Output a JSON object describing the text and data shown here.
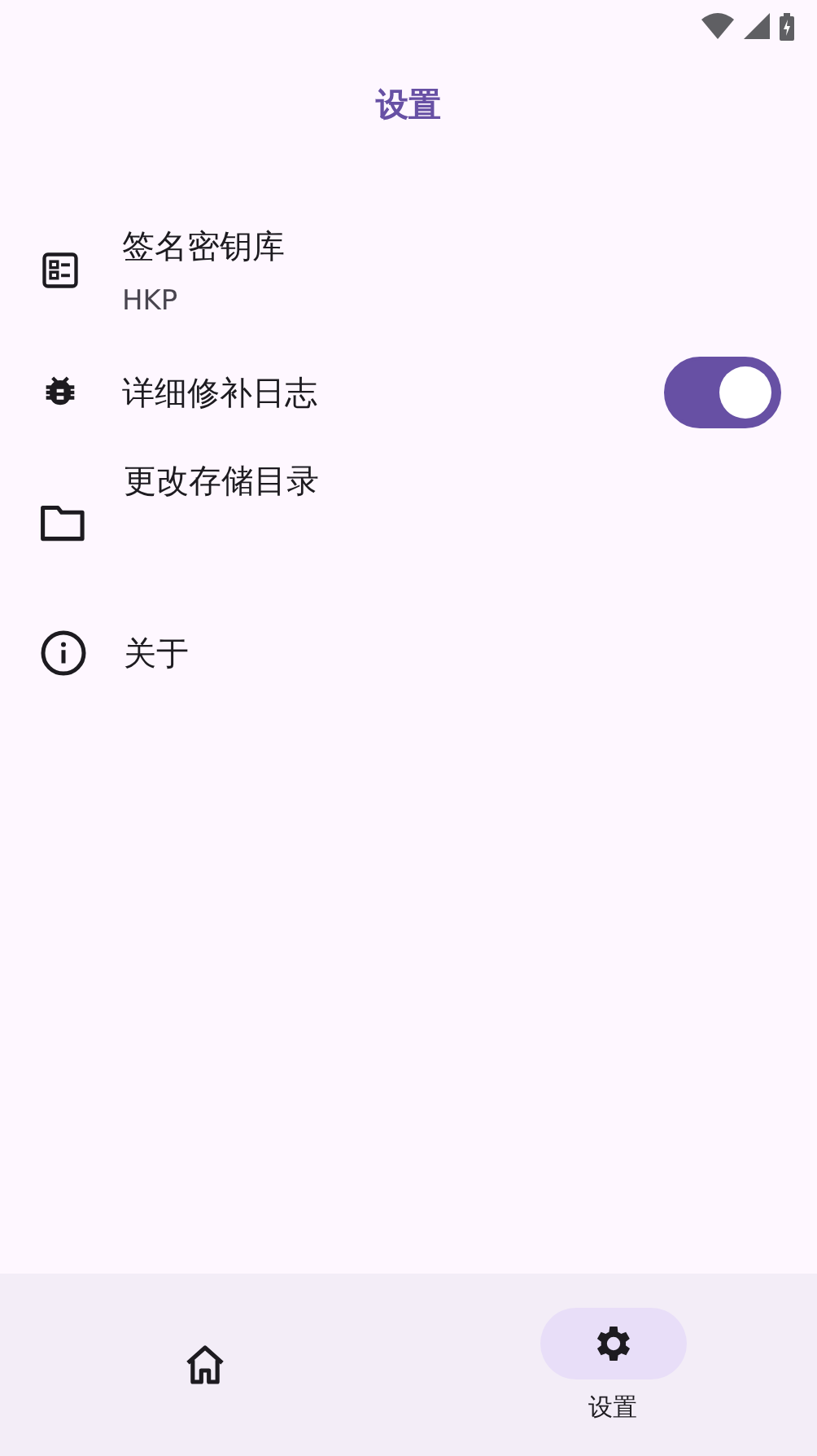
{
  "app_bar": {
    "title": "设置"
  },
  "settings": [
    {
      "kind": "keystore",
      "title": "签名密钥库",
      "subtitle": "HKP"
    },
    {
      "kind": "toggle",
      "title": "详细修补日志",
      "on": true
    },
    {
      "kind": "folder",
      "title": "更改存储目录"
    },
    {
      "kind": "about",
      "title": "关于"
    }
  ],
  "bottom_nav": [
    {
      "kind": "home",
      "selected": false
    },
    {
      "kind": "settings",
      "label": "设置",
      "selected": true
    }
  ]
}
